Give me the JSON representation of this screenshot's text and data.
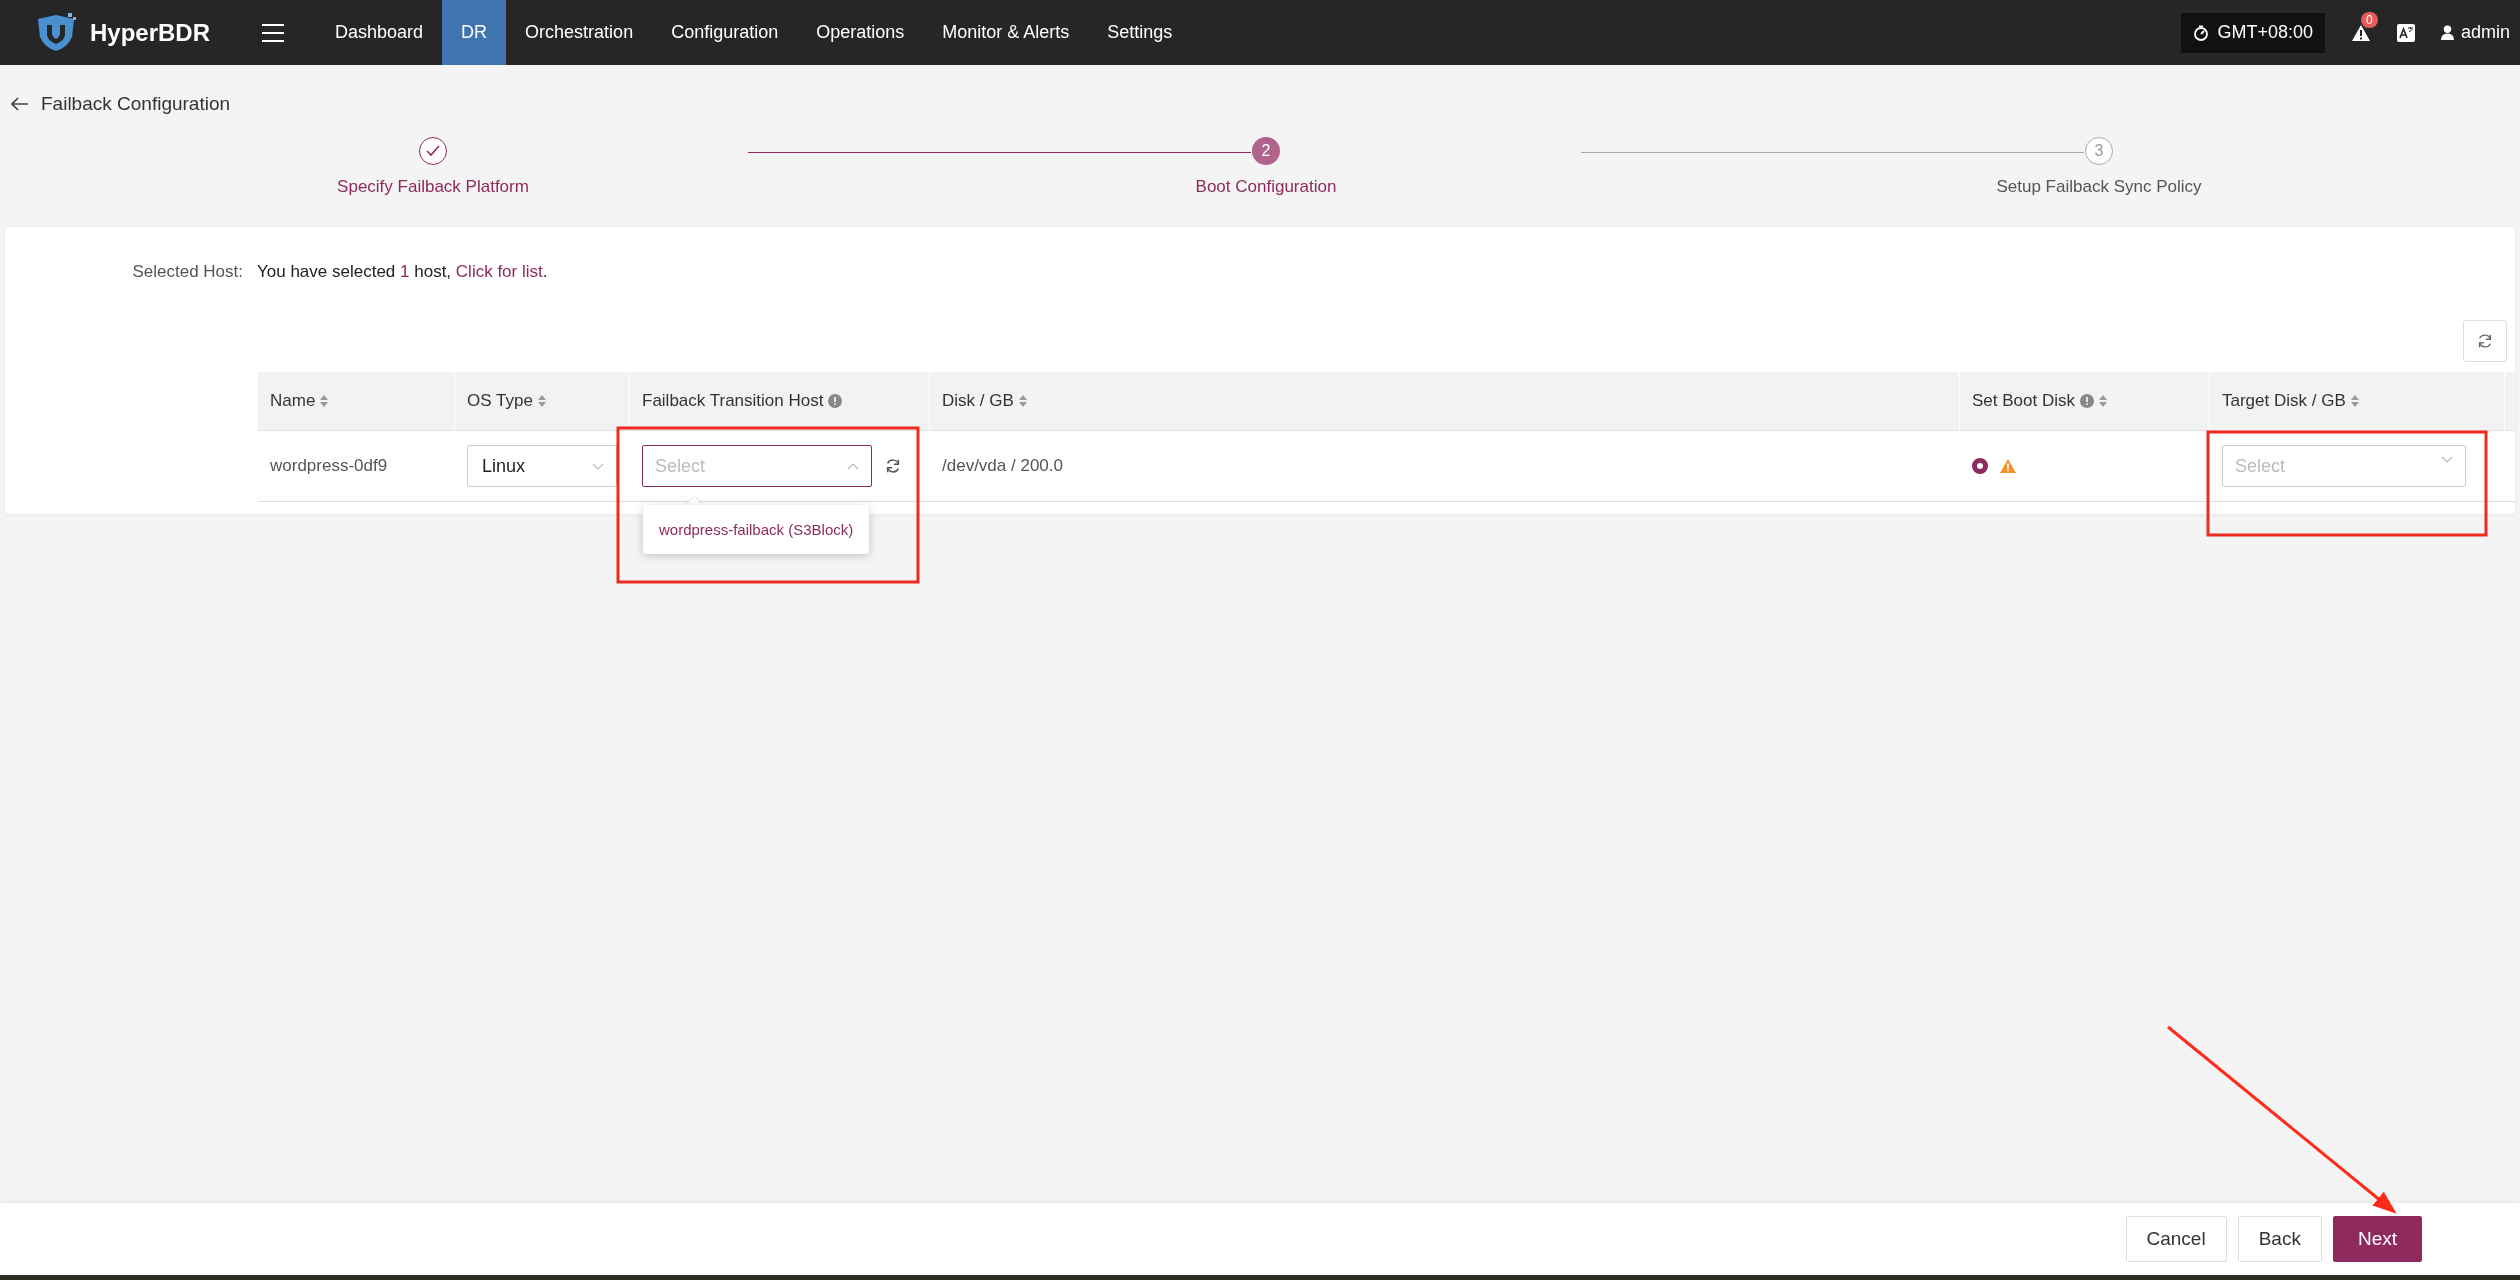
{
  "nav": {
    "brand": "HyperBDR",
    "items": [
      {
        "label": "Dashboard",
        "selected": false
      },
      {
        "label": "DR",
        "selected": true
      },
      {
        "label": "Orchestration",
        "selected": false
      },
      {
        "label": "Configuration",
        "selected": false
      },
      {
        "label": "Operations",
        "selected": false
      },
      {
        "label": "Monitor & Alerts",
        "selected": false
      },
      {
        "label": "Settings",
        "selected": false
      }
    ],
    "timezone": "GMT+08:00",
    "alert_count": "0",
    "user": "admin"
  },
  "page_title": "Failback Configuration",
  "steps": [
    {
      "label": "Specify Failback Platform",
      "completed": true,
      "selected": false
    },
    {
      "number": "2",
      "label": "Boot Configuration",
      "completed": false,
      "selected": true
    },
    {
      "number": "3",
      "label": "Setup Failback Sync Policy",
      "completed": false,
      "selected": false
    }
  ],
  "selected_host": {
    "label": "Selected Host:",
    "prefix": "You have selected ",
    "count": "1",
    "middle": " host, ",
    "link": "Click for list",
    "suffix": "."
  },
  "table": {
    "columns": [
      {
        "label": "Name",
        "sortable": true,
        "info": false
      },
      {
        "label": "OS Type",
        "sortable": true,
        "info": false
      },
      {
        "label": "Failback Transition Host",
        "sortable": false,
        "info": true
      },
      {
        "label": "Disk / GB",
        "sortable": true,
        "info": false
      },
      {
        "label": "Set Boot Disk",
        "sortable": true,
        "info": true
      },
      {
        "label": "Target Disk / GB",
        "sortable": true,
        "info": false
      }
    ],
    "rows": [
      {
        "name": "wordpress-0df9",
        "os_type": "Linux",
        "transition_host": {
          "placeholder": "Select",
          "expanded": true,
          "options": [
            "wordpress-failback (S3Block)"
          ]
        },
        "disk": "/dev/vda / 200.0",
        "boot_disk": {
          "selected": true,
          "warning": true
        },
        "target_disk": {
          "placeholder": "Select"
        }
      }
    ]
  },
  "footer": {
    "buttons": [
      {
        "label": "Cancel",
        "kind": "default"
      },
      {
        "label": "Back",
        "kind": "default"
      },
      {
        "label": "Next",
        "kind": "primary"
      }
    ]
  }
}
